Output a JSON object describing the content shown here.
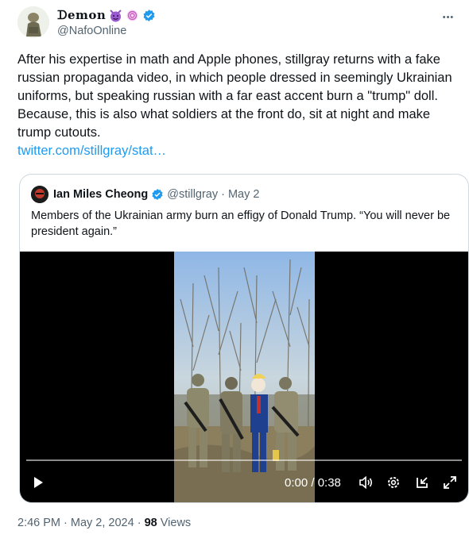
{
  "author": {
    "display_name": "ᗪemon",
    "handle": "@NafoOnline"
  },
  "more_label": "•••",
  "tweet": {
    "text": "After his expertise in math and Apple phones, stillgray returns with a fake russian propaganda video, in which people dressed in seemingly Ukrainian uniforms, but speaking russian with a far east accent burn a \"trump\" doll. Because, this is also what soldiers at the front do, sit at night and make trump cutouts.",
    "link": "twitter.com/stillgray/stat…"
  },
  "quote": {
    "name": "Ian Miles Cheong",
    "handle": "@stillgray",
    "separator": "·",
    "date": "May 2",
    "text": "Members of the Ukrainian army burn an effigy of Donald Trump. “You will never be president again.”"
  },
  "video": {
    "time": "0:00 / 0:38",
    "progress": 0.0
  },
  "footer": {
    "timestamp": "2:46 PM · May 2, 2024",
    "separator": " · ",
    "views_count": "98",
    "views_label": " Views"
  },
  "colors": {
    "link": "#1d9bf0",
    "verified": "#1d9bf0",
    "secondary_text": "#536471",
    "border": "#cfd9de"
  },
  "icons": [
    "devil-emoji-icon",
    "cyclone-emoji-icon",
    "verified-badge-icon",
    "more-icon",
    "play-icon",
    "volume-icon",
    "settings-icon",
    "dock-icon",
    "fullscreen-icon"
  ]
}
